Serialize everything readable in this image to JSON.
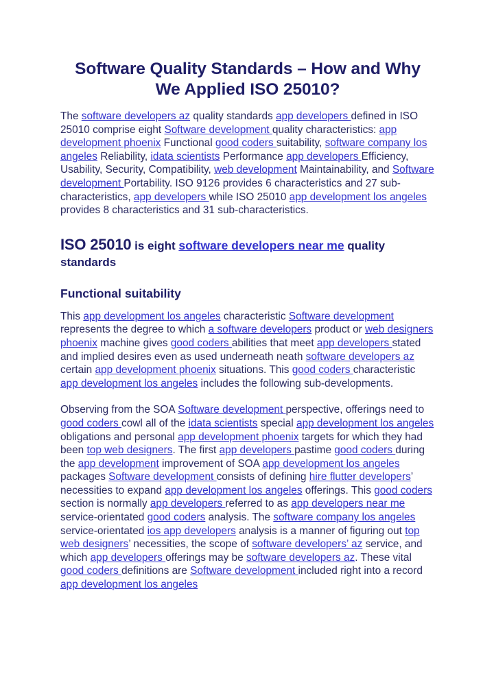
{
  "document": {
    "title": "Software Quality Standards – How and Why We Applied ISO 25010?",
    "colors": {
      "heading": "#201f68",
      "body_text": "#2b2b63",
      "link": "#3232cc",
      "background": "#ffffff"
    },
    "paragraph_1": {
      "runs": [
        {
          "text": "The ",
          "type": "text"
        },
        {
          "text": "software developers az",
          "type": "link"
        },
        {
          "text": " quality standards ",
          "type": "text"
        },
        {
          "text": "app developers ",
          "type": "link"
        },
        {
          "text": "defined in ISO 25010 comprise eight ",
          "type": "text"
        },
        {
          "text": "Software development ",
          "type": "link"
        },
        {
          "text": "quality characteristics: ",
          "type": "text"
        },
        {
          "text": "app development phoenix",
          "type": "link"
        },
        {
          "text": " Functional ",
          "type": "text"
        },
        {
          "text": "good coders ",
          "type": "link"
        },
        {
          "text": "suitability, ",
          "type": "text"
        },
        {
          "text": "software company los angeles",
          "type": "link"
        },
        {
          "text": " Reliability, ",
          "type": "text"
        },
        {
          "text": "idata scientists",
          "type": "link"
        },
        {
          "text": " Performance ",
          "type": "text"
        },
        {
          "text": "app developers ",
          "type": "link"
        },
        {
          "text": "Efficiency, Usability, Security, Compatibility, ",
          "type": "text"
        },
        {
          "text": "web development",
          "type": "link"
        },
        {
          "text": " Maintainability, and ",
          "type": "text"
        },
        {
          "text": "Software development ",
          "type": "link"
        },
        {
          "text": "Portability. ISO 9126 provides 6 characteristics and 27 sub-characteristics, ",
          "type": "text"
        },
        {
          "text": "app developers ",
          "type": "link"
        },
        {
          "text": "while ISO 25010 ",
          "type": "text"
        },
        {
          "text": "app development los angeles",
          "type": "link"
        },
        {
          "text": " provides 8 characteristics and 31 sub-characteristics.",
          "type": "text"
        }
      ]
    },
    "heading_iso": {
      "part_big": "ISO 25010",
      "part_mid": " is eight ",
      "part_link": "software developers near me",
      "part_tail": " quality standards"
    },
    "heading_functional": "Functional suitability",
    "paragraph_2": {
      "runs": [
        {
          "text": "This ",
          "type": "text"
        },
        {
          "text": "app development los angeles",
          "type": "link"
        },
        {
          "text": " characteristic ",
          "type": "text"
        },
        {
          "text": "Software development",
          "type": "link"
        },
        {
          "text": " represents the degree to which ",
          "type": "text"
        },
        {
          "text": "a software developers",
          "type": "link"
        },
        {
          "text": " product or ",
          "type": "text"
        },
        {
          "text": "web designers phoenix",
          "type": "link"
        },
        {
          "text": " machine gives ",
          "type": "text"
        },
        {
          "text": "good coders ",
          "type": "link"
        },
        {
          "text": "abilities that meet ",
          "type": "text"
        },
        {
          "text": "app developers ",
          "type": "link"
        },
        {
          "text": "stated and implied desires even as used underneath neath ",
          "type": "text"
        },
        {
          "text": "software developers az",
          "type": "link"
        },
        {
          "text": " certain ",
          "type": "text"
        },
        {
          "text": "app development phoenix",
          "type": "link"
        },
        {
          "text": " situations. This ",
          "type": "text"
        },
        {
          "text": "good coders ",
          "type": "link"
        },
        {
          "text": "characteristic ",
          "type": "text"
        },
        {
          "text": "app development los angeles",
          "type": "link"
        },
        {
          "text": " includes the following sub-developments.",
          "type": "text"
        }
      ]
    },
    "paragraph_3": {
      "runs": [
        {
          "text": "Observing from the SOA ",
          "type": "text"
        },
        {
          "text": "Software development ",
          "type": "link"
        },
        {
          "text": "perspective, offerings need to ",
          "type": "text"
        },
        {
          "text": "good coders ",
          "type": "link"
        },
        {
          "text": "cowl all of the ",
          "type": "text"
        },
        {
          "text": "idata scientists",
          "type": "link"
        },
        {
          "text": " special ",
          "type": "text"
        },
        {
          "text": "app development los angeles",
          "type": "link"
        },
        {
          "text": " obligations and personal ",
          "type": "text"
        },
        {
          "text": "app development phoenix",
          "type": "link"
        },
        {
          "text": " targets for which they had been ",
          "type": "text"
        },
        {
          "text": "top web designers",
          "type": "link"
        },
        {
          "text": ". The first ",
          "type": "text"
        },
        {
          "text": "app developers ",
          "type": "link"
        },
        {
          "text": "pastime ",
          "type": "text"
        },
        {
          "text": "good coders ",
          "type": "link"
        },
        {
          "text": "during the ",
          "type": "text"
        },
        {
          "text": "app development",
          "type": "link"
        },
        {
          "text": " improvement of SOA ",
          "type": "text"
        },
        {
          "text": "app development los angeles",
          "type": "link"
        },
        {
          "text": " packages ",
          "type": "text"
        },
        {
          "text": "Software development ",
          "type": "link"
        },
        {
          "text": "consists of defining ",
          "type": "text"
        },
        {
          "text": "hire flutter developers",
          "type": "link"
        },
        {
          "text": "’ necessities to expand ",
          "type": "text"
        },
        {
          "text": "app development los angeles",
          "type": "link"
        },
        {
          "text": " offerings. This ",
          "type": "text"
        },
        {
          "text": "good coders",
          "type": "link"
        },
        {
          "text": " section is normally ",
          "type": "text"
        },
        {
          "text": "app developers ",
          "type": "link"
        },
        {
          "text": "referred to as ",
          "type": "text"
        },
        {
          "text": "app developers near me",
          "type": "link"
        },
        {
          "text": " service-orientated ",
          "type": "text"
        },
        {
          "text": "good coders",
          "type": "link"
        },
        {
          "text": " analysis. The ",
          "type": "text"
        },
        {
          "text": "software company los angeles",
          "type": "link"
        },
        {
          "text": " service-orientated ",
          "type": "text"
        },
        {
          "text": "ios app developers",
          "type": "link"
        },
        {
          "text": " analysis is a manner of figuring out ",
          "type": "text"
        },
        {
          "text": "top web designers",
          "type": "link"
        },
        {
          "text": "’ necessities, the scope of ",
          "type": "text"
        },
        {
          "text": "software developers’ az",
          "type": "link"
        },
        {
          "text": " service, and which ",
          "type": "text"
        },
        {
          "text": "app developers ",
          "type": "link"
        },
        {
          "text": "offerings may be ",
          "type": "text"
        },
        {
          "text": "software developers az",
          "type": "link"
        },
        {
          "text": ". These vital ",
          "type": "text"
        },
        {
          "text": "good coders ",
          "type": "link"
        },
        {
          "text": "definitions are ",
          "type": "text"
        },
        {
          "text": "Software development ",
          "type": "link"
        },
        {
          "text": "included right into a record ",
          "type": "text"
        },
        {
          "text": "app development los angeles",
          "type": "link"
        }
      ]
    }
  }
}
